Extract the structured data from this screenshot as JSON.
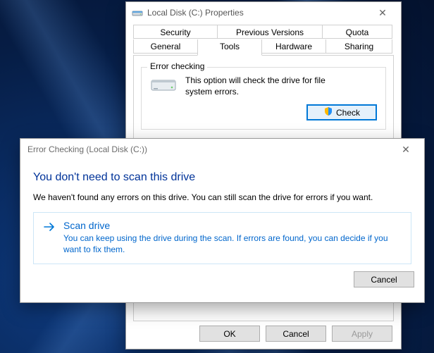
{
  "glyphs": {
    "close": "✕"
  },
  "properties_window": {
    "title": "Local Disk (C:) Properties",
    "tabs_row1": [
      "Security",
      "Previous Versions",
      "Quota"
    ],
    "tabs_row2": [
      "General",
      "Tools",
      "Hardware",
      "Sharing"
    ],
    "active_tab": "Tools",
    "error_checking": {
      "legend": "Error checking",
      "desc": "This option will check the drive for file system errors.",
      "button": "Check"
    },
    "buttons": {
      "ok": "OK",
      "cancel": "Cancel",
      "apply": "Apply"
    }
  },
  "error_checking_dialog": {
    "title": "Error Checking (Local Disk (C:))",
    "heading": "You don't need to scan this drive",
    "subtext": "We haven't found any errors on this drive. You can still scan the drive for errors if you want.",
    "command": {
      "title": "Scan drive",
      "desc": "You can keep using the drive during the scan. If errors are found, you can decide if you want to fix them."
    },
    "cancel": "Cancel"
  }
}
